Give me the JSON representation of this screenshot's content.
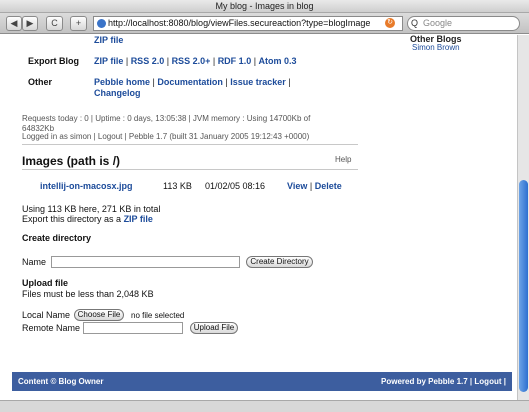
{
  "window": {
    "title": "My blog - Images in blog"
  },
  "toolbar": {
    "back": "◀",
    "forward": "▶",
    "reload": "C",
    "add": "+",
    "url": "http://localhost:8080/blog/viewFiles.secureaction?type=blogImage",
    "search_placeholder": "Google",
    "reload_symbol": "↻",
    "search_symbol": "Q"
  },
  "sidebar": {
    "other_blogs_title": "Other Blogs",
    "other_blogs_link": "Simon Brown"
  },
  "export": {
    "top_link": "ZIP file",
    "label": "Export Blog",
    "links": [
      "ZIP file",
      "RSS 2.0",
      "RSS 2.0+",
      "RDF 1.0",
      "Atom 0.3"
    ]
  },
  "other": {
    "label": "Other",
    "links": [
      "Pebble home",
      "Documentation",
      "Issue tracker",
      "Changelog"
    ]
  },
  "stats": {
    "line1": "Requests today : 0 | Uptime : 0 days, 13:05:38 | JVM memory : Using 14700Kb of",
    "line2": "64832Kb",
    "line3": "Logged in as simon | Logout | Pebble 1.7 (built 31 January 2005 19:12:43 +0000)"
  },
  "images": {
    "heading": "Images (path is /)",
    "help": "Help",
    "file": {
      "name": "intellij-on-macosx.jpg",
      "size": "113 KB",
      "date": "01/02/05 08:16",
      "view": "View",
      "delete": "Delete"
    },
    "usage": "Using 113 KB here, 271 KB in total",
    "export_prefix": "Export this directory as a",
    "export_link": "ZIP file"
  },
  "create_dir": {
    "heading": "Create directory",
    "name_label": "Name",
    "button": "Create Directory"
  },
  "upload": {
    "heading": "Upload file",
    "note": "Files must be less than 2,048 KB",
    "local_label": "Local Name",
    "choose_button": "Choose File",
    "no_file": "no file selected",
    "remote_label": "Remote Name",
    "upload_button": "Upload File"
  },
  "footer": {
    "left": "Content © Blog Owner",
    "right_prefix": "Powered by Pebble 1.7 |",
    "logout": "Logout",
    "right_suffix": "|"
  }
}
